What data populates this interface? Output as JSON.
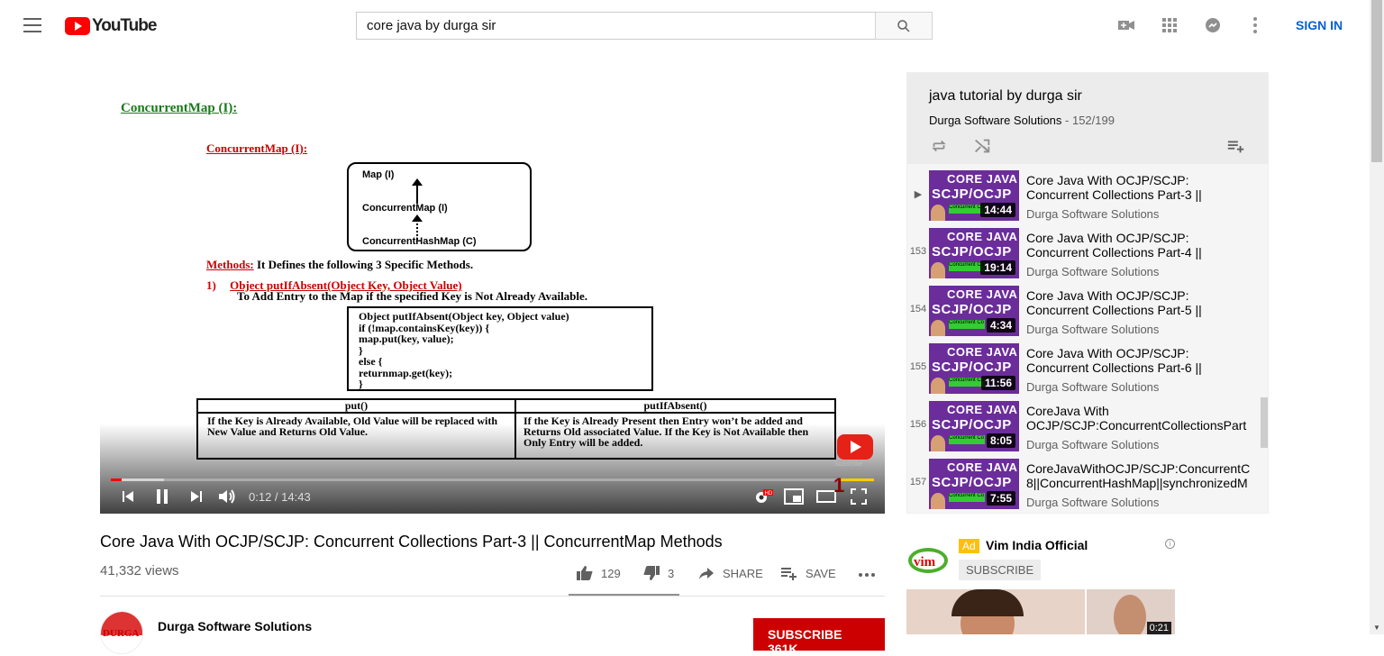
{
  "header": {
    "logo_text": "YouTube",
    "search_value": "core java by durga sir",
    "sign_in": "SIGN IN",
    "icons": [
      "menu-icon",
      "search-icon",
      "create-video-icon",
      "apps-icon",
      "messages-icon",
      "more-vert-icon"
    ]
  },
  "player": {
    "time_current": "0:12",
    "time_total": "14:43",
    "time_display": "0:12 / 14:43",
    "progress_fraction": 0.0136,
    "buffer_fraction": 0.07,
    "badge_number": "1",
    "watermark": "Subscribe",
    "slide": {
      "heading": "ConcurrentMap (I):",
      "sub_heading": "ConcurrentMap (I):",
      "hierarchy": [
        "Map (I)",
        "ConcurrentMap (I)",
        "ConcurrentHashMap (C)"
      ],
      "methods_label": "Methods:",
      "methods_text": "It Defines the following 3 Specific Methods.",
      "item_number": "1)",
      "item_title": "Object putIfAbsent(Object Key, Object Value)",
      "item_desc": "To Add Entry to the Map if the specified Key is Not Already Available.",
      "code_lines": [
        "Object putIfAbsent(Object key, Object value)",
        "if (!map.containsKey(key)) {",
        "map.put(key, value);",
        "}",
        "else {",
        "returnmap.get(key);",
        "}"
      ],
      "table_headers": [
        "put()",
        "putIfAbsent()"
      ],
      "table_cells": [
        "If the Key is Already Available, Old Value will be replaced with New Value and Returns Old Value.",
        "If the Key is Already Present then Entry won’t be added and Returns Old associated Value. If the Key is Not Available then Only Entry will be added."
      ]
    }
  },
  "video": {
    "title": "Core Java With OCJP/SCJP: Concurrent Collections Part-3 || ConcurrentMap Methods",
    "views": "41,332 views",
    "likes": "129",
    "dislikes": "3",
    "share": "SHARE",
    "save": "SAVE",
    "channel": "Durga Software Solutions",
    "subscribe": "SUBSCRIBE 361K",
    "avatar_text": "DURGA"
  },
  "playlist": {
    "title": "java tutorial by durga sir",
    "owner": "Durga Software Solutions",
    "count": " - 152/199",
    "items": [
      {
        "index": "▶",
        "title": "Core Java With OCJP/SCJP: Concurrent Collections Part-3 ||",
        "channel": "Durga Software Solutions",
        "duration": "14:44"
      },
      {
        "index": "153",
        "title": "Core Java With OCJP/SCJP: Concurrent Collections Part-4 ||",
        "channel": "Durga Software Solutions",
        "duration": "19:14"
      },
      {
        "index": "154",
        "title": "Core Java With OCJP/SCJP: Concurrent Collections Part-5 ||",
        "channel": "Durga Software Solutions",
        "duration": "4:34"
      },
      {
        "index": "155",
        "title": "Core Java With OCJP/SCJP: Concurrent Collections Part-6 ||",
        "channel": "Durga Software Solutions",
        "duration": "11:56"
      },
      {
        "index": "156",
        "title": "CoreJava With OCJP/SCJP:ConcurrentCollectionsPart",
        "channel": "Durga Software Solutions",
        "duration": "8:05"
      },
      {
        "index": "157",
        "title": "CoreJavaWithOCJP/SCJP:ConcurrentC 8||ConcurrentHashMap||synchronizedM",
        "channel": "Durga Software Solutions",
        "duration": "7:55"
      }
    ],
    "thumb": {
      "line1": "CORE JAVA",
      "line2": "SCJP/OCJP",
      "tag": "Concurrent Co"
    }
  },
  "ad": {
    "badge": "Ad",
    "name": "Vim India Official",
    "subscribe": "SUBSCRIBE",
    "duration": "0:21",
    "logo_text": "vim"
  },
  "colors": {
    "brand_red": "#ff0000",
    "link_blue": "#065fd4",
    "subscribe_red": "#cc0000",
    "thumb_purple": "#6b2d9a"
  }
}
